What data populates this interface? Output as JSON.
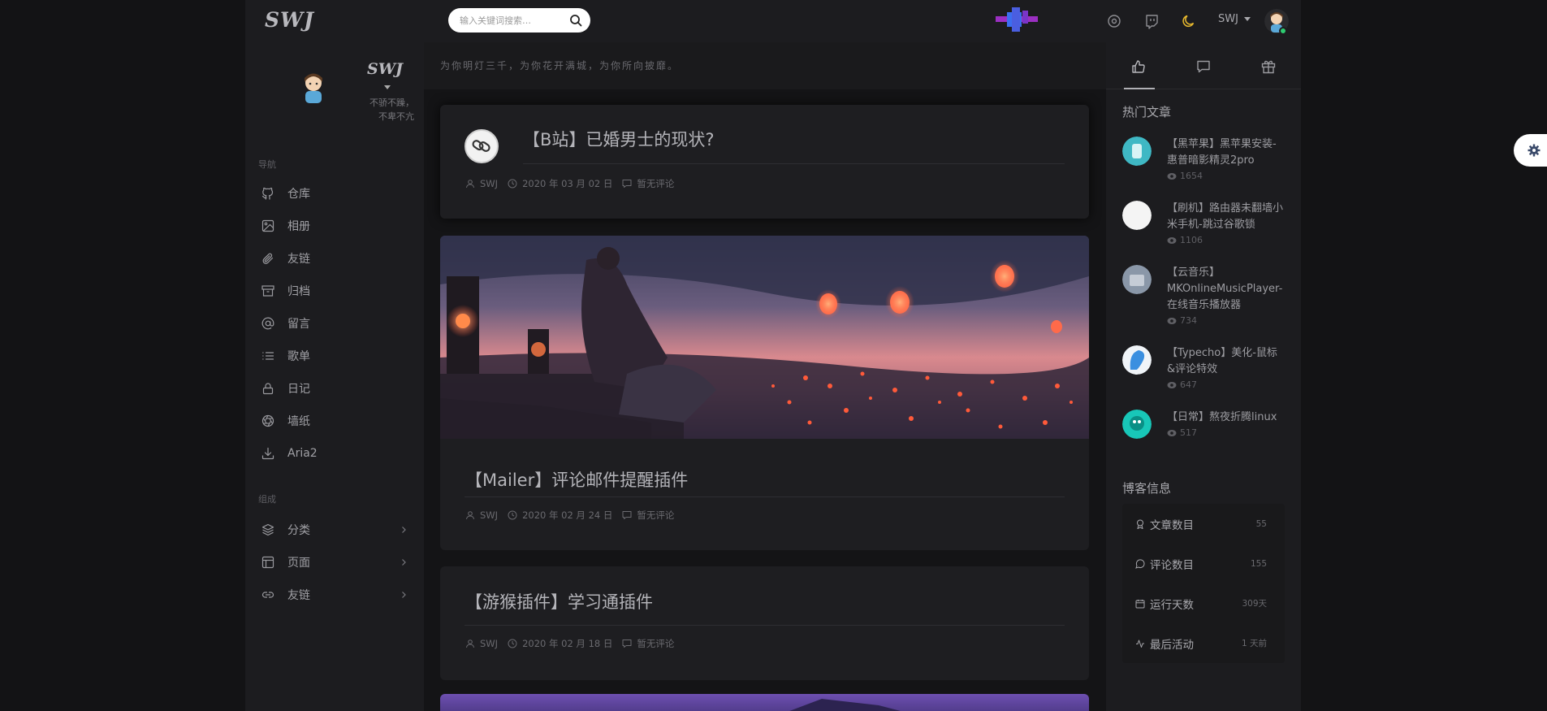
{
  "header": {
    "logo": "SWJ",
    "search_placeholder": "输入关键词搜索…",
    "username": "SWJ"
  },
  "sidebar": {
    "logo": "SWJ",
    "motto_line1": "不骄不躁，",
    "motto_line2": "不卑不亢",
    "nav_title": "导航",
    "nav": [
      {
        "label": "仓库",
        "icon": "github-icon"
      },
      {
        "label": "相册",
        "icon": "image-icon"
      },
      {
        "label": "友链",
        "icon": "paperclip-icon"
      },
      {
        "label": "归档",
        "icon": "archive-icon"
      },
      {
        "label": "留言",
        "icon": "at-icon"
      },
      {
        "label": "歌单",
        "icon": "list-icon"
      },
      {
        "label": "日记",
        "icon": "lock-icon"
      },
      {
        "label": "墙纸",
        "icon": "aperture-icon"
      },
      {
        "label": "Aria2",
        "icon": "download-icon"
      }
    ],
    "group_title": "组成",
    "groups": [
      {
        "label": "分类",
        "icon": "layers-icon"
      },
      {
        "label": "页面",
        "icon": "layout-icon"
      },
      {
        "label": "友链",
        "icon": "link-icon"
      }
    ]
  },
  "main": {
    "banner": "为你明灯三千，为你花开满城，为你所向披靡。",
    "posts": [
      {
        "title": "【B站】已婚男士的现状?",
        "author": "SWJ",
        "date": "2020 年 03 月 02 日",
        "comments": "暂无评论"
      },
      {
        "title": "【Mailer】评论邮件提醒插件",
        "author": "SWJ",
        "date": "2020 年 02 月 24 日",
        "comments": "暂无评论"
      },
      {
        "title": "【游猴插件】学习通插件",
        "author": "SWJ",
        "date": "2020 年 02 月 18 日",
        "comments": "暂无评论"
      }
    ]
  },
  "right": {
    "hot_title": "热门文章",
    "hot": [
      {
        "title": "【黑苹果】黑苹果安装-惠普暗影精灵2pro",
        "views": "1654",
        "color": "#3fb8c4"
      },
      {
        "title": "【刷机】路由器未翻墙小米手机-跳过谷歌锁",
        "views": "1106",
        "color": "#e03a3a"
      },
      {
        "title": "【云音乐】MKOnlineMusicPlayer-在线音乐播放器",
        "views": "734",
        "color": "#8a97a8"
      },
      {
        "title": "【Typecho】美化-鼠标&评论特效",
        "views": "647",
        "color": "#3a8fe0"
      },
      {
        "title": "【日常】熬夜折腾linux",
        "views": "517",
        "color": "#18c7b8"
      }
    ],
    "info_title": "博客信息",
    "info": [
      {
        "label": "文章数目",
        "value": "55"
      },
      {
        "label": "评论数目",
        "value": "155"
      },
      {
        "label": "运行天数",
        "value": "309天"
      },
      {
        "label": "最后活动",
        "value": "1 天前"
      }
    ]
  }
}
